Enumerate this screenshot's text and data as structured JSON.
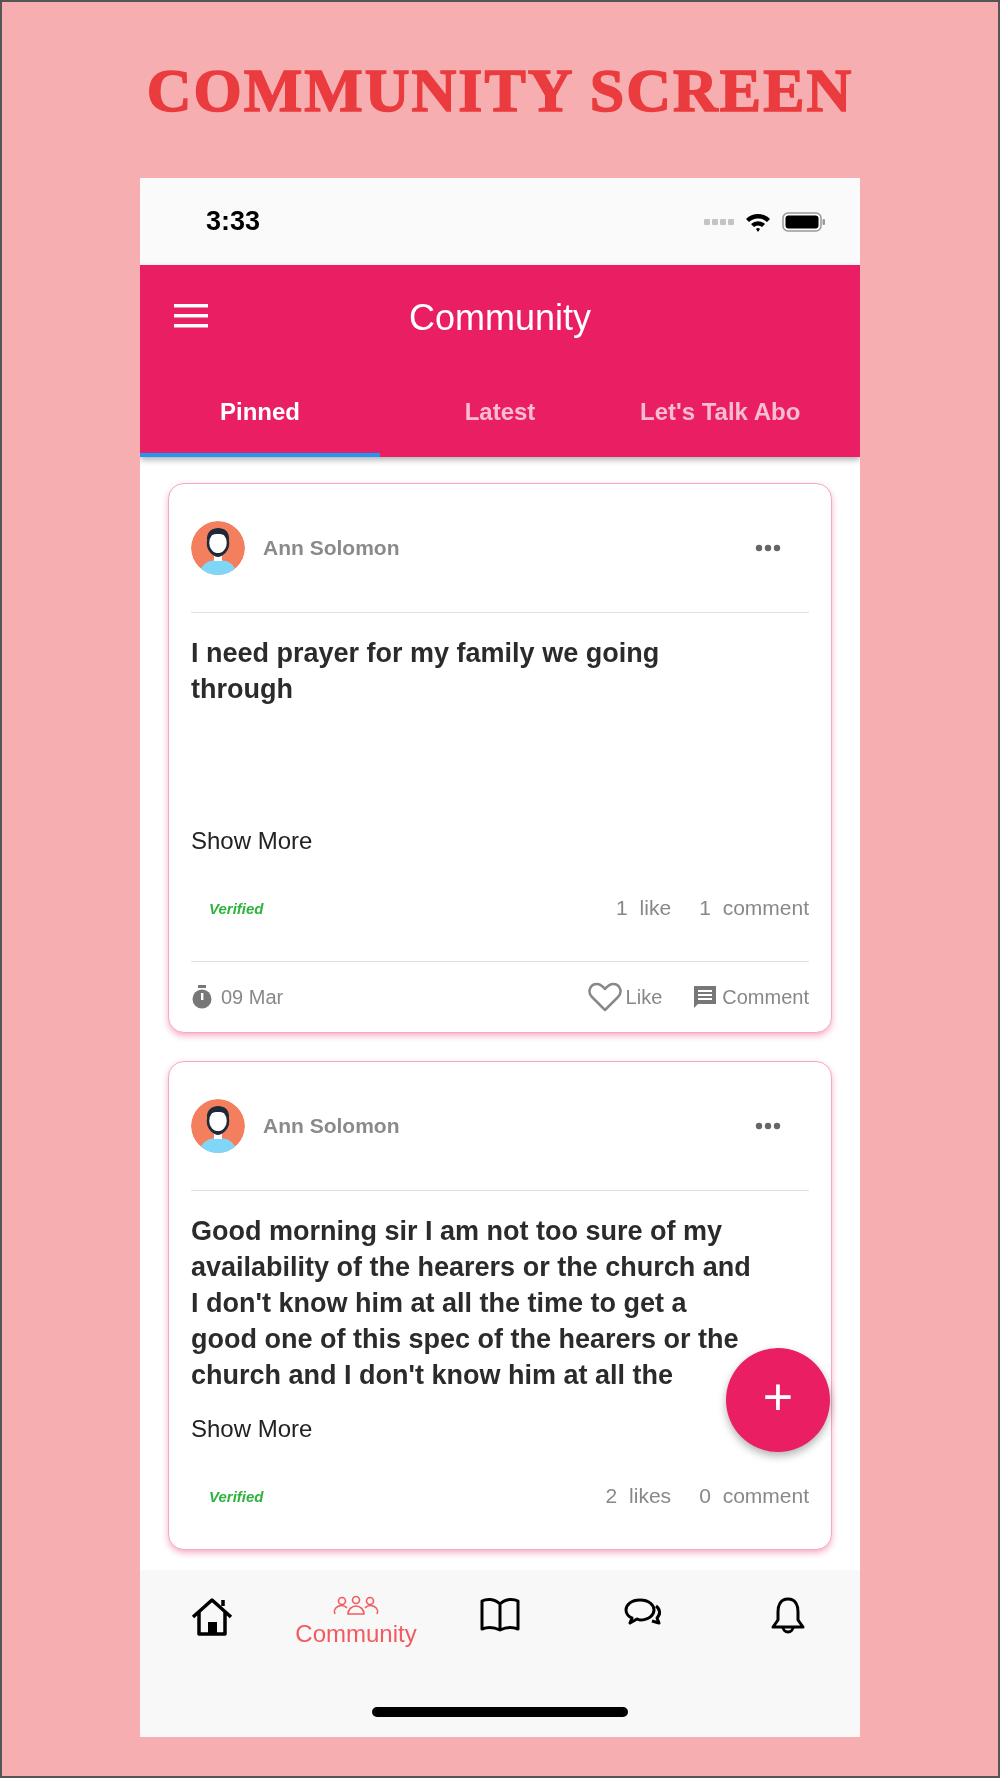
{
  "page_title": "COMMUNITY SCREEN",
  "status_bar": {
    "time": "3:33"
  },
  "app_bar": {
    "title": "Community"
  },
  "tabs": [
    {
      "label": "Pinned",
      "selected": true
    },
    {
      "label": "Latest",
      "selected": false
    },
    {
      "label": "Let's Talk Abo",
      "selected": false
    }
  ],
  "posts": [
    {
      "author": "Ann Solomon",
      "body": "I need prayer for my family we going through",
      "show_more": "Show More",
      "badge": "Verified",
      "likes": "1 like",
      "comments": "1 comment",
      "footer": {
        "date": "09 Mar",
        "like": "Like",
        "comment": "Comment"
      }
    },
    {
      "author": "Ann Solomon",
      "body": "Good morning sir I am not too sure of my availability of the hearers or the church and I don't know him at all the time to get a good one of this spec of the hearers or the church and I don't know him at all the",
      "show_more": "Show More",
      "badge": "Verified",
      "likes": "2 likes",
      "comments": "0 comment"
    }
  ],
  "fab": {
    "label": "+"
  },
  "nav": [
    {
      "kind": "home",
      "selected": false
    },
    {
      "kind": "community",
      "selected": true,
      "label": "Community"
    },
    {
      "kind": "book",
      "selected": false
    },
    {
      "kind": "chat",
      "selected": false
    },
    {
      "kind": "bell",
      "selected": false
    }
  ]
}
